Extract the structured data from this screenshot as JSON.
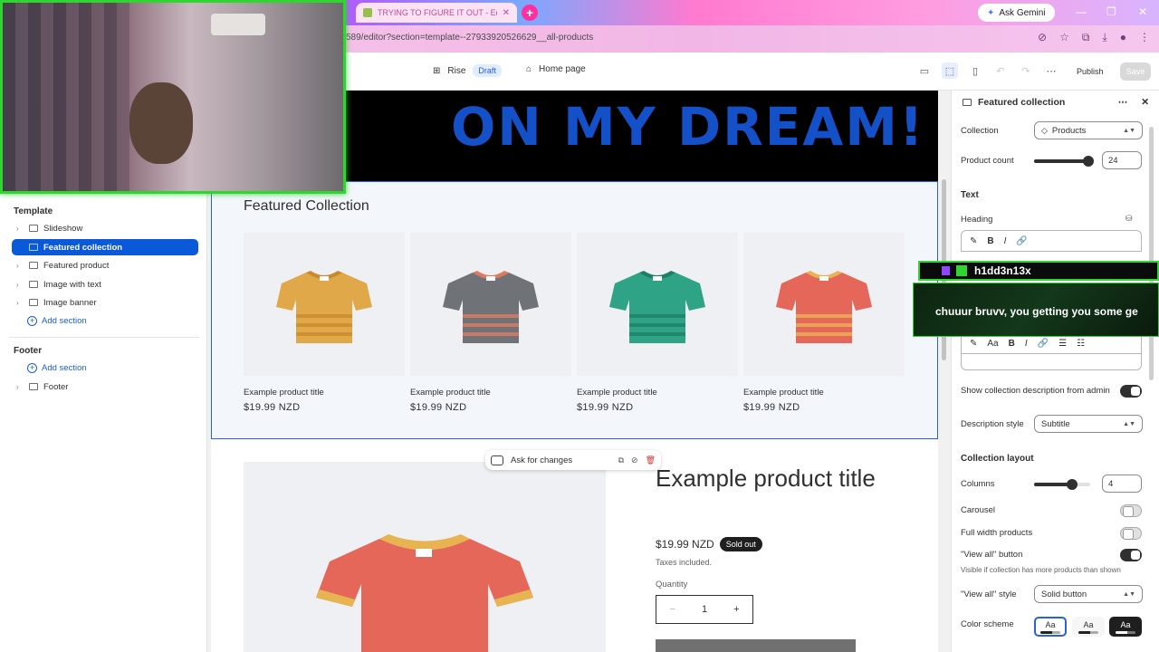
{
  "browser": {
    "tab_title": "TRYING TO FIGURE IT OUT - Ed",
    "url": "589/editor?section=template--27933920526629__all-products",
    "ask_gemini": "Ask Gemini"
  },
  "editor_header": {
    "theme_name": "Rise",
    "theme_status": "Draft",
    "page": "Home page",
    "publish": "Publish",
    "save": "Save"
  },
  "sidebar": {
    "template_heading": "Template",
    "template_items": [
      {
        "label": "Slideshow"
      },
      {
        "label": "Featured collection"
      },
      {
        "label": "Featured product"
      },
      {
        "label": "Image with text"
      },
      {
        "label": "Image banner"
      }
    ],
    "add_section": "Add section",
    "footer_heading": "Footer",
    "footer_add_section": "Add section",
    "footer_item": "Footer"
  },
  "preview": {
    "banner_text": "ON MY DREAM!",
    "featured_collection_title": "Featured Collection",
    "products": [
      {
        "title": "Example product title",
        "price": "$19.99 NZD",
        "color": "#e0a848",
        "stripe": "#c98a2e"
      },
      {
        "title": "Example product title",
        "price": "$19.99 NZD",
        "color": "#6f7377",
        "stripe": "#e07a5f"
      },
      {
        "title": "Example product title",
        "price": "$19.99 NZD",
        "color": "#2fa385",
        "stripe": "#1d7f66"
      },
      {
        "title": "Example product title",
        "price": "$19.99 NZD",
        "color": "#e5675a",
        "stripe": "#e8b451"
      }
    ],
    "featured_product": {
      "title": "Example product title",
      "price": "$19.99 NZD",
      "badge": "Sold out",
      "taxes": "Taxes included.",
      "quantity_label": "Quantity",
      "quantity": "1",
      "minus": "−",
      "plus": "+"
    },
    "floating_bar": {
      "ask": "Ask for changes"
    }
  },
  "settings": {
    "title": "Featured collection",
    "collection_label": "Collection",
    "collection_value": "Products",
    "product_count_label": "Product count",
    "product_count_value": "24",
    "product_count_fraction": 0.96,
    "text_heading": "Text",
    "heading_label": "Heading",
    "show_description_label": "Show collection description from admin",
    "show_description_on": true,
    "description_style_label": "Description style",
    "description_style_value": "Subtitle",
    "collection_layout_heading": "Collection layout",
    "columns_label": "Columns",
    "columns_value": "4",
    "columns_fraction": 0.67,
    "carousel_label": "Carousel",
    "full_width_label": "Full width products",
    "view_all_button_label": "\"View all\" button",
    "view_all_help": "Visible if collection has more products than shown",
    "view_all_style_label": "\"View all\" style",
    "view_all_style_value": "Solid button",
    "color_scheme_label": "Color scheme",
    "swatch_text": "Aa"
  },
  "overlay": {
    "chat_user": "h1dd3n13x",
    "chat_message": "chuuur bruvv, you getting you some ge"
  }
}
